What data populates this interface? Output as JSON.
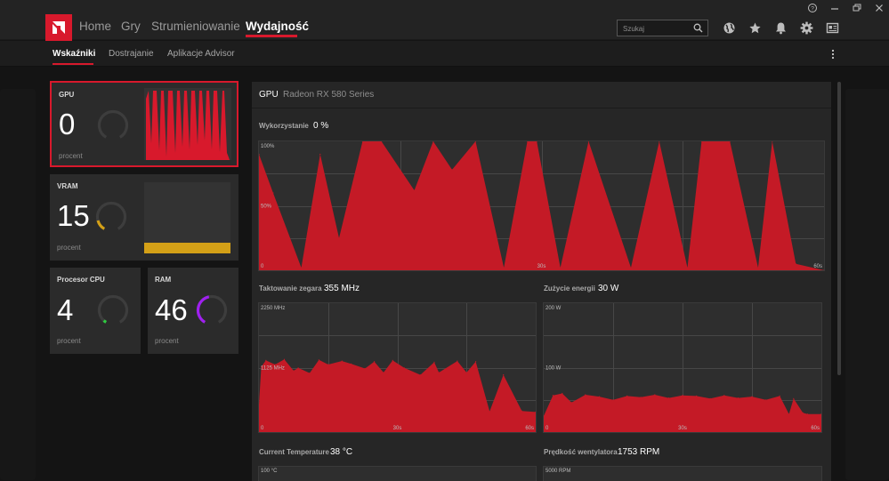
{
  "nav": {
    "tabs": [
      {
        "label": "Home",
        "active": false
      },
      {
        "label": "Gry",
        "active": false
      },
      {
        "label": "Strumieniowanie",
        "active": false
      },
      {
        "label": "Wydajność",
        "active": true
      }
    ],
    "search_placeholder": "Szukaj"
  },
  "subnav": {
    "tabs": [
      {
        "label": "Wskaźniki",
        "active": true
      },
      {
        "label": "Dostrajanie",
        "active": false
      },
      {
        "label": "Aplikacje Advisor",
        "active": false
      }
    ]
  },
  "metrics": {
    "gpu": {
      "title": "GPU",
      "value": "0",
      "unit": "procent",
      "percent": 0
    },
    "vram": {
      "title": "VRAM",
      "value": "15",
      "unit": "procent",
      "percent": 15
    },
    "cpu": {
      "title": "Procesor CPU",
      "value": "4",
      "unit": "procent",
      "percent": 4
    },
    "ram": {
      "title": "RAM",
      "value": "46",
      "unit": "procent",
      "percent": 46
    }
  },
  "colors": {
    "accent": "#d8192c",
    "vram": "#d4a017",
    "cpu": "#2ecc40",
    "ram": "#a020f0"
  },
  "panel": {
    "title": "GPU",
    "subtitle": "Radeon RX 580 Series"
  },
  "utilization": {
    "label": "Wykorzystanie",
    "value": "0 %",
    "y_top": "100%",
    "y_mid": "50%",
    "x_start": "0",
    "x_mid": "30s",
    "x_end": "60s"
  },
  "clock": {
    "label": "Taktowanie zegara",
    "value": "355 MHz",
    "y_top": "2250 MHz",
    "y_mid": "1125 MHz",
    "x_start": "0",
    "x_mid": "30s",
    "x_end": "60s"
  },
  "power": {
    "label": "Zużycie energii",
    "value": "30 W",
    "y_top": "200 W",
    "y_mid": "100 W",
    "x_start": "0",
    "x_mid": "30s",
    "x_end": "60s"
  },
  "temperature": {
    "label": "Current Temperature",
    "value": "38 °C",
    "y_top": "100 °C"
  },
  "fan": {
    "label": "Prędkość wentylatora",
    "value": "1753 RPM",
    "y_top": "5000 RPM"
  },
  "chart_data": [
    {
      "type": "area",
      "name": "utilization",
      "ylim": [
        0,
        100
      ],
      "x": [
        0,
        1.5,
        4.5,
        6.5,
        8.5,
        11,
        13,
        16.5,
        18.5,
        20.5,
        23,
        26,
        28.5,
        29.5,
        32,
        35,
        39.5,
        42.5,
        45.5,
        47,
        50,
        53,
        54.5,
        57,
        60
      ],
      "y": [
        90,
        60,
        2,
        90,
        25,
        100,
        100,
        62,
        100,
        78,
        100,
        2,
        100,
        100,
        2,
        100,
        2,
        100,
        2,
        100,
        100,
        2,
        100,
        5,
        0
      ]
    },
    {
      "type": "area",
      "name": "clock",
      "ylim": [
        0,
        2250
      ],
      "x": [
        0,
        0.5,
        1.5,
        3.5,
        5.5,
        7.5,
        8.5,
        11,
        13,
        15,
        18,
        20,
        23,
        25,
        27,
        29,
        31.5,
        35,
        38,
        39,
        43,
        45,
        47,
        50,
        53,
        57,
        60
      ],
      "y": [
        480,
        1140,
        1250,
        1180,
        1270,
        1070,
        1120,
        1030,
        1260,
        1180,
        1240,
        1190,
        1110,
        1230,
        1040,
        1250,
        1120,
        1000,
        1220,
        1040,
        1240,
        1040,
        1230,
        360,
        1000,
        370,
        350
      ]
    },
    {
      "type": "area",
      "name": "power",
      "ylim": [
        0,
        200
      ],
      "x": [
        0,
        2,
        4,
        6,
        9,
        12,
        15,
        18,
        21,
        24,
        27,
        30,
        33,
        36,
        39,
        42,
        45,
        48,
        51,
        53,
        54,
        56,
        57,
        60
      ],
      "y": [
        25,
        57,
        60,
        46,
        58,
        55,
        50,
        56,
        54,
        58,
        53,
        57,
        56,
        52,
        57,
        53,
        55,
        50,
        56,
        28,
        52,
        30,
        28,
        28
      ]
    }
  ]
}
